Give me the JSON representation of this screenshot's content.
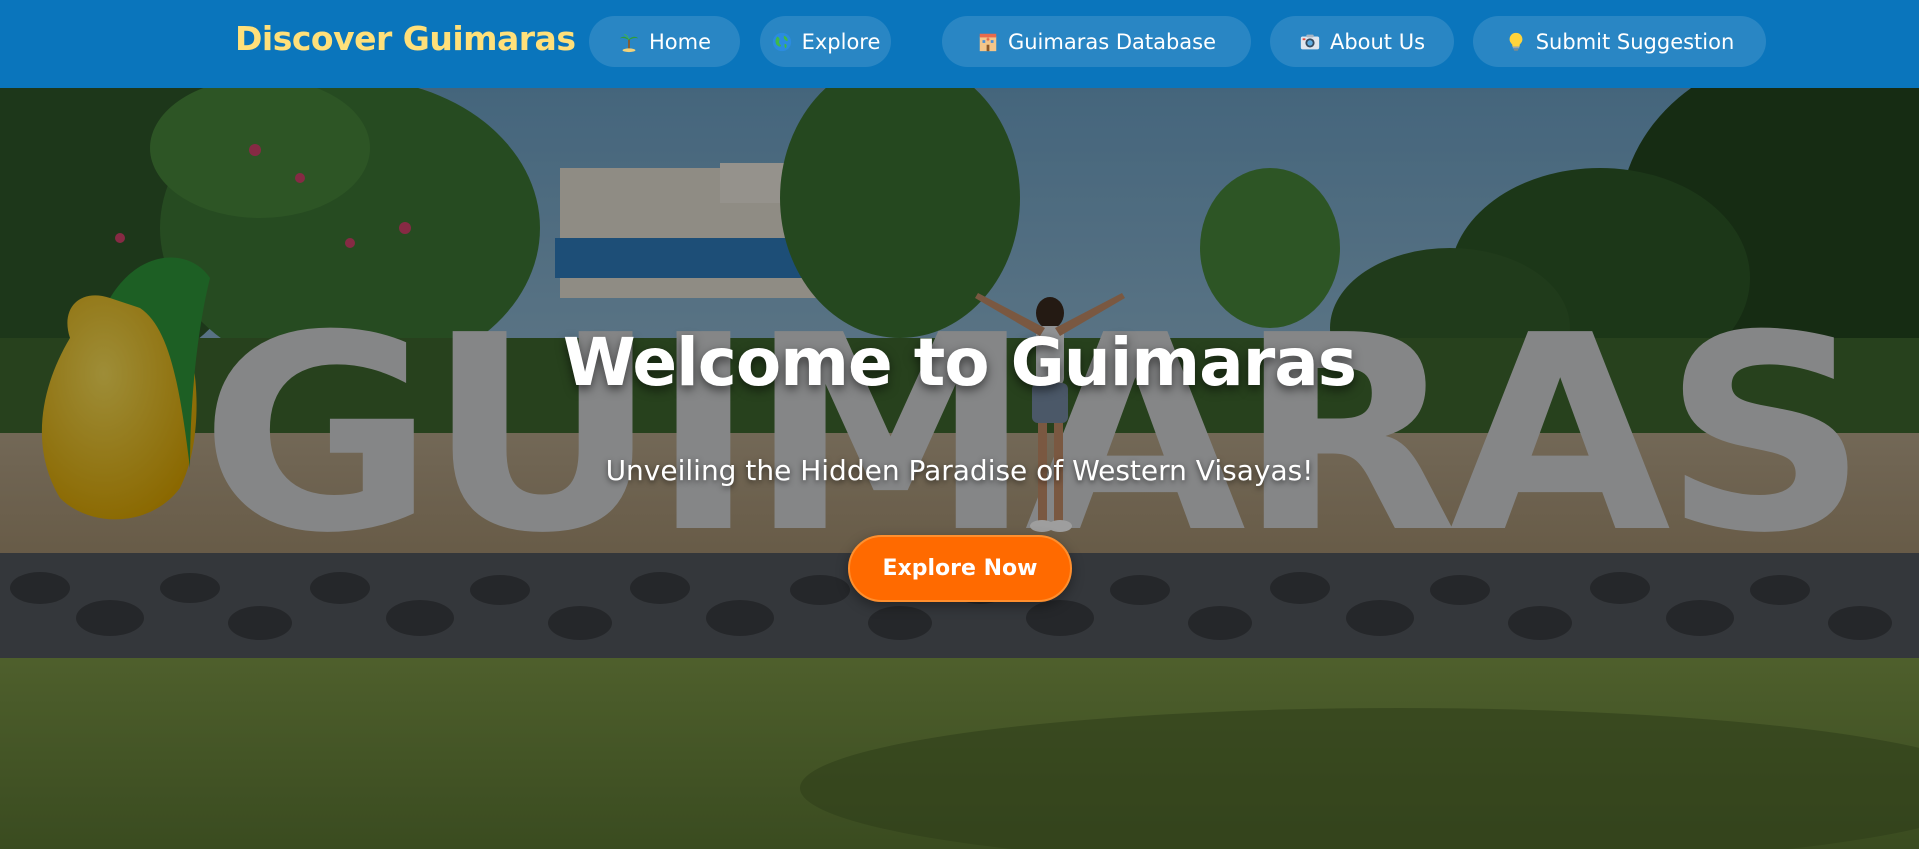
{
  "site": {
    "brand": "Discover Guimaras"
  },
  "nav": {
    "items": [
      {
        "label": "Home",
        "icon": "palm-tree-icon"
      },
      {
        "label": "Explore",
        "icon": "globe-icon"
      },
      {
        "label": "Guimaras Database",
        "icon": "building-icon"
      },
      {
        "label": "About Us",
        "icon": "camera-icon"
      },
      {
        "label": "Submit Suggestion",
        "icon": "lightbulb-icon"
      }
    ]
  },
  "hero": {
    "title": "Welcome to Guimaras",
    "subtitle": "Unveiling the Hidden Paradise of Western Visayas!",
    "cta_label": "Explore Now",
    "sign_text": "GUIMARAS"
  },
  "colors": {
    "navbar": "#0a75bc",
    "brand": "#ffe07a",
    "cta": "#ff6a00"
  }
}
